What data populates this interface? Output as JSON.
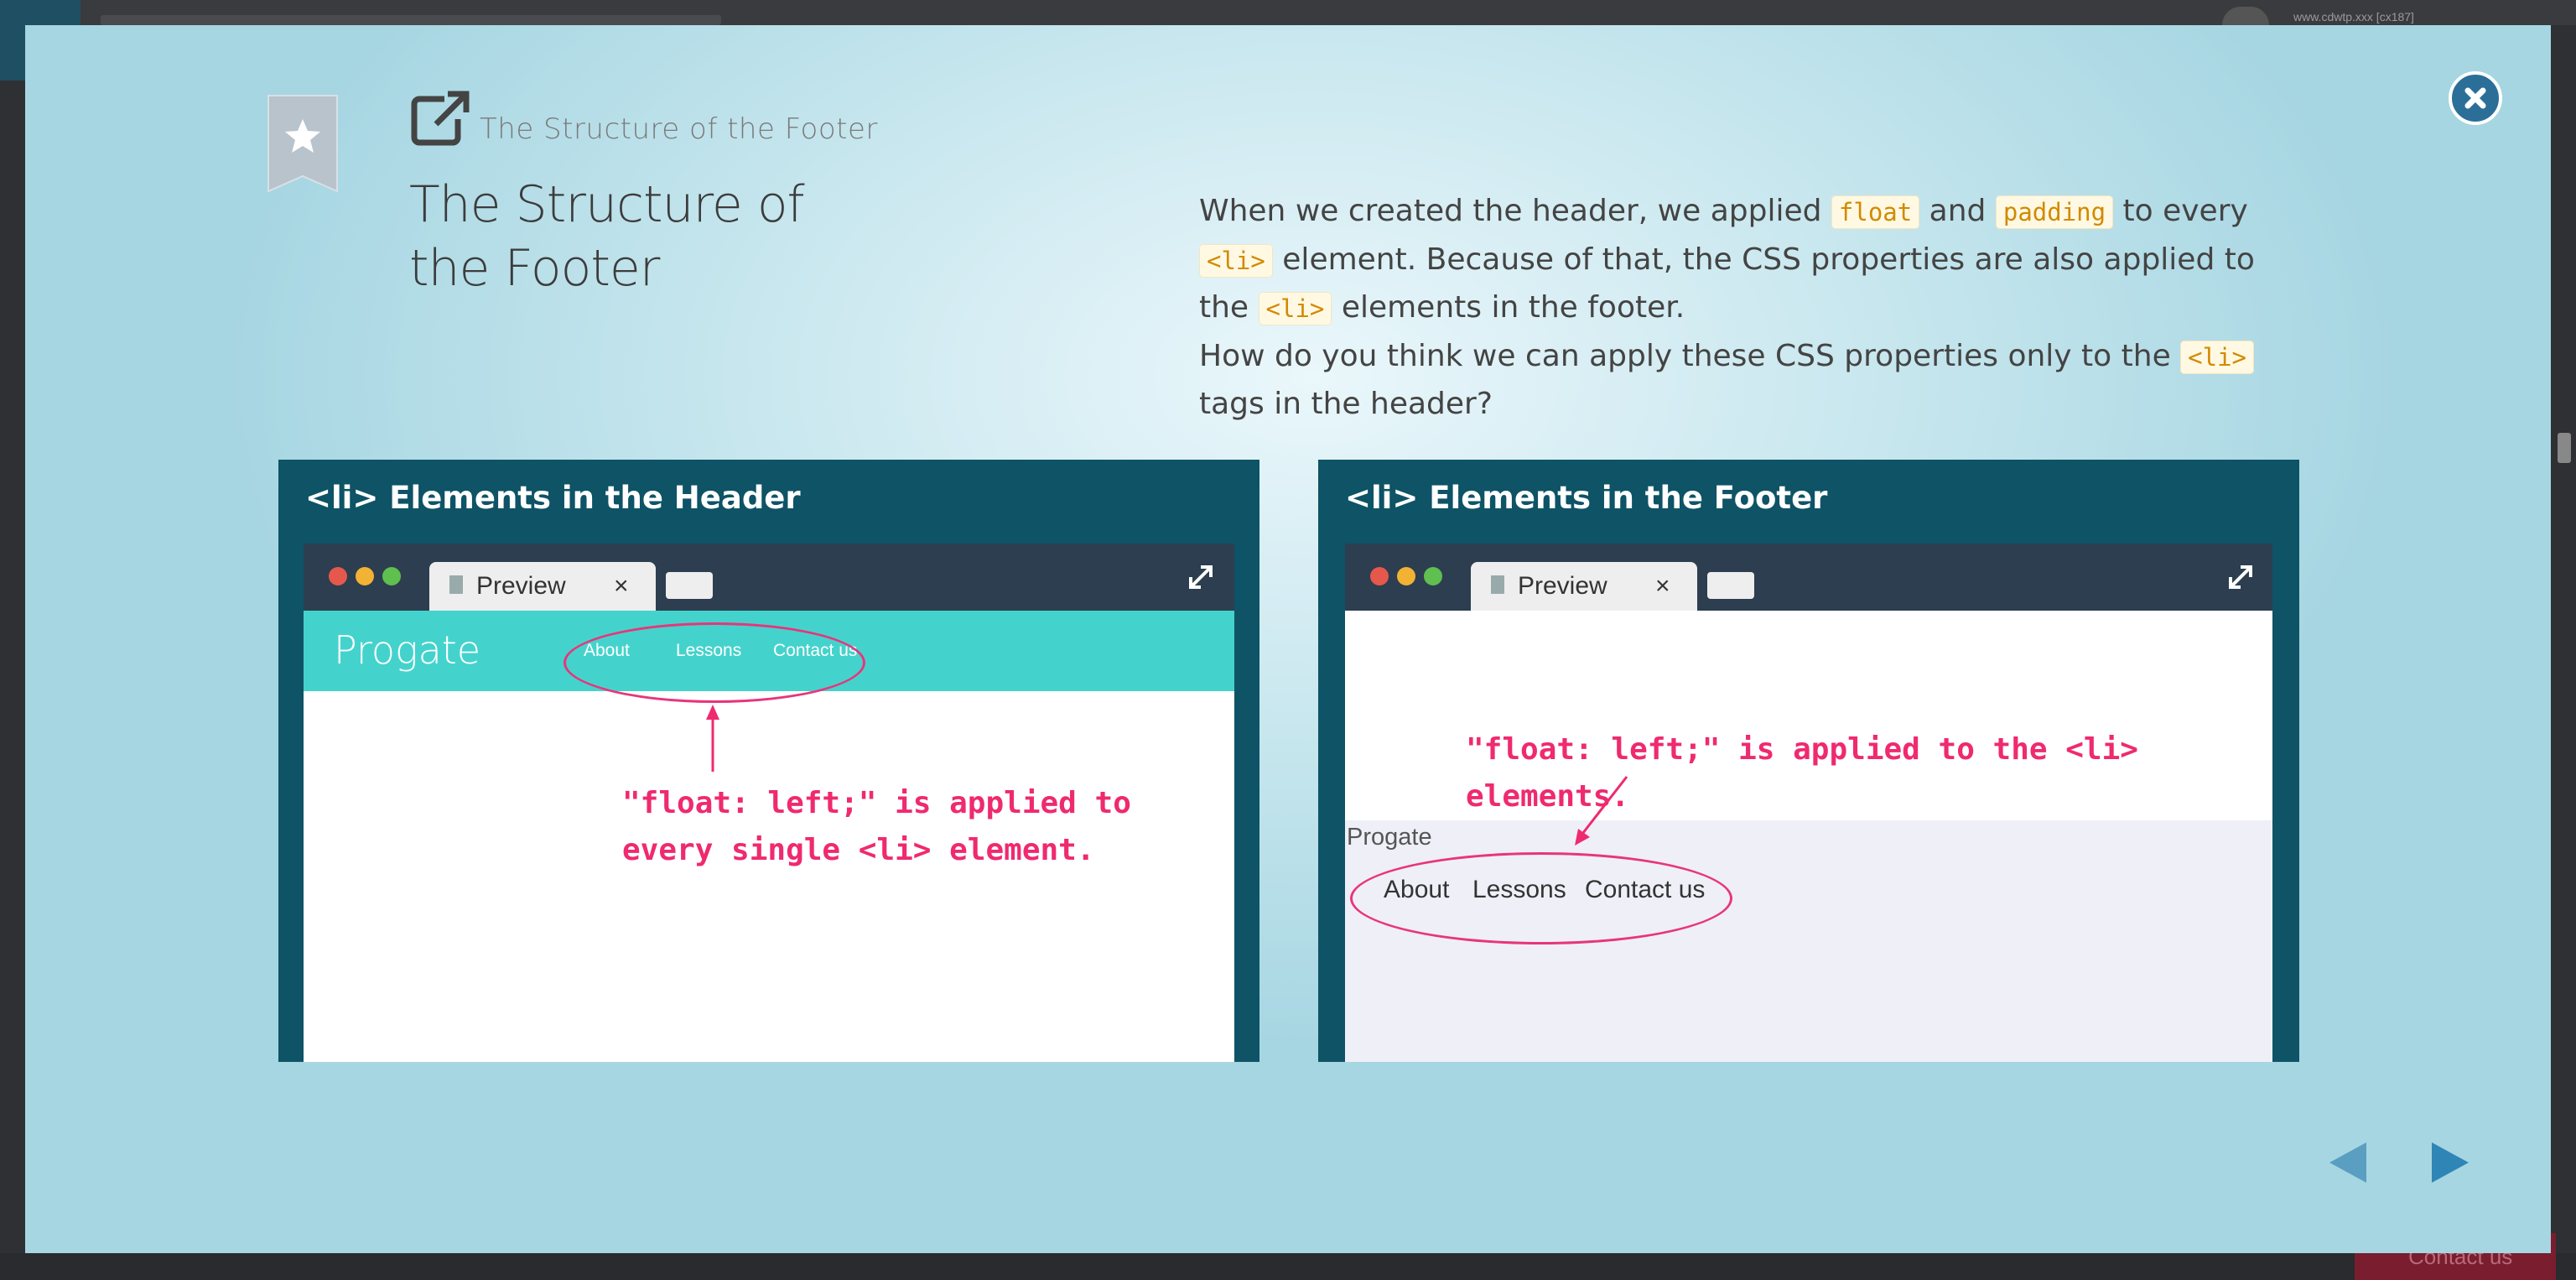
{
  "background": {
    "url_text": "www.cdwtp.xxx [cx187]",
    "contact_label": "Contact us"
  },
  "modal": {
    "subtitle": "The Structure of the Footer",
    "title": "The Structure of the Footer",
    "desc": {
      "p1": "When we created the header, we applied ",
      "code_float": "float",
      "p2": " and ",
      "code_padding": "padding",
      "p3": " to every ",
      "code_li1": "<li>",
      "p4": " element. Because of that, the CSS properties are also applied to the ",
      "code_li2": "<li>",
      "p5": " elements in the footer.",
      "p6": "How do you think we can apply these CSS properties only to the ",
      "code_li3": "<li>",
      "p7": " tags in the header?"
    },
    "figures": {
      "header": {
        "panel_title": "<li> Elements in the Header",
        "tab_label": "Preview",
        "tab_close": "×",
        "logo": "Progate",
        "nav": [
          "About",
          "Lessons",
          "Contact us"
        ],
        "note_line1": "\"float: left;\" is applied to",
        "note_line2": "every single <li> element."
      },
      "footer": {
        "panel_title": "<li> Elements in the Footer",
        "tab_label": "Preview",
        "tab_close": "×",
        "note": "\"float: left;\" is applied to the <li> elements.",
        "logo": "Progate",
        "nav": [
          "About",
          "Lessons",
          "Contact us"
        ]
      }
    },
    "icons": {
      "close": "close-icon",
      "bookmark": "bookmark-star-icon",
      "external": "external-link-icon",
      "prev": "prev-arrow-icon",
      "next": "next-arrow-icon"
    },
    "colors": {
      "accent": "#2b6f99",
      "panel": "#0e5366",
      "header_bar": "#44d3cc",
      "note": "#ef2a6f",
      "code": "#d28a00"
    }
  }
}
